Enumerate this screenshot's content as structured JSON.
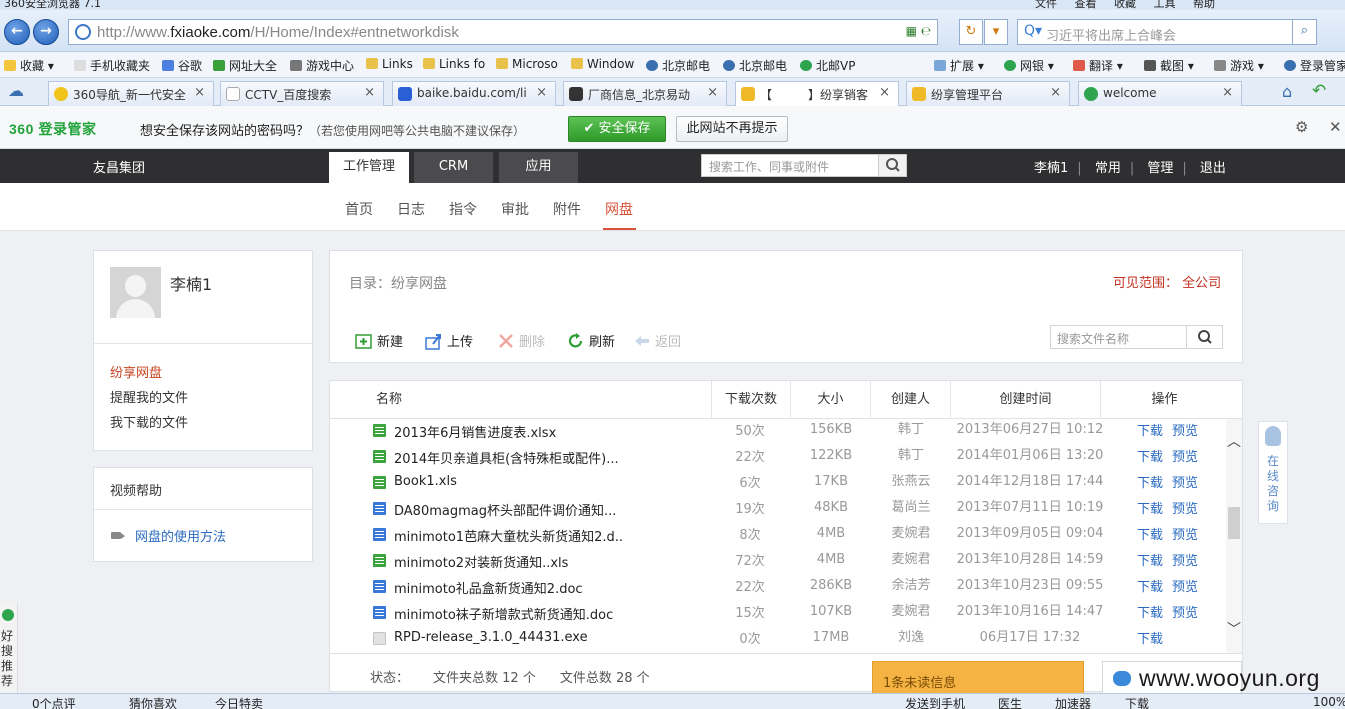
{
  "browser": {
    "title": "360安全浏览器 7.1",
    "menu": [
      "文件",
      "查看",
      "收藏",
      "工具",
      "帮助"
    ],
    "url_prefix": "http://www.",
    "url_domain": "fxiaoke.com",
    "url_path": "/H/Home/Index#entnetworkdisk",
    "search_placeholder": "习近平将出席上合峰会",
    "favorites": [
      "收藏",
      "手机收藏夹",
      "谷歌",
      "网址大全",
      "游戏中心",
      "Links",
      "Links fo",
      "Microso",
      "Window",
      "北京邮电",
      "北京邮电",
      "北邮VP",
      "扩展",
      "网银",
      "翻译",
      "截图",
      "游戏",
      "登录管家"
    ],
    "tabs": [
      "360导航_新一代安全",
      "CCTV_百度搜索",
      "baike.baidu.com/li",
      "厂商信息_北京易动",
      "【　　　】纷享销客",
      "纷享管理平台",
      "welcome"
    ]
  },
  "password_bar": {
    "brand": "360",
    "brand_suffix": "登录管家",
    "message": "想安全保存该网站的密码吗？",
    "note": "（若您使用网吧等公共电脑不建议保存）",
    "save_label": "安全保存",
    "no_prompt_label": "此网站不再提示"
  },
  "header": {
    "company": "友昌集团",
    "main_tabs": [
      "工作管理",
      "CRM",
      "应用"
    ],
    "search_placeholder": "搜索工作、同事或附件",
    "user": "李楠1",
    "links": [
      "常用",
      "管理",
      "退出"
    ]
  },
  "subnav": [
    "首页",
    "日志",
    "指令",
    "审批",
    "附件",
    "网盘"
  ],
  "profile": {
    "name": "李楠1",
    "menu": [
      "纷享网盘",
      "提醒我的文件",
      "我下载的文件"
    ]
  },
  "help": {
    "title": "视频帮助",
    "link": "网盘的使用方法"
  },
  "disk": {
    "dir_label": "目录：纷享网盘",
    "scope_label": "可见范围：",
    "scope_value": "全公司",
    "toolbar": [
      "新建",
      "上传",
      "删除",
      "刷新",
      "返回"
    ],
    "search_placeholder": "搜索文件名称",
    "columns": [
      "名称",
      "下载次数",
      "大小",
      "创建人",
      "创建时间",
      "操作"
    ],
    "files": [
      {
        "type": "xls",
        "name": "2013年6月销售进度表.xlsx",
        "downloads": "50次",
        "size": "156KB",
        "creator": "韩丁",
        "time": "2013年06月27日 10:12",
        "dl": "下载",
        "pv": "预览"
      },
      {
        "type": "xls",
        "name": "2014年贝亲道具柜(含特殊柜或配件)...",
        "downloads": "22次",
        "size": "122KB",
        "creator": "韩丁",
        "time": "2014年01月06日 13:20",
        "dl": "下载",
        "pv": "预览"
      },
      {
        "type": "xls",
        "name": "Book1.xls",
        "downloads": "6次",
        "size": "17KB",
        "creator": "张燕云",
        "time": "2014年12月18日 17:44",
        "dl": "下载",
        "pv": "预览"
      },
      {
        "type": "doc",
        "name": "DA80magmag杯头部配件调价通知...",
        "downloads": "19次",
        "size": "48KB",
        "creator": "葛尚兰",
        "time": "2013年07月11日 10:19",
        "dl": "下载",
        "pv": "预览"
      },
      {
        "type": "doc",
        "name": "minimoto1芭麻大童枕头新货通知2.d...",
        "downloads": "8次",
        "size": "4MB",
        "creator": "麦婉君",
        "time": "2013年09月05日 09:04",
        "dl": "下载",
        "pv": "预览"
      },
      {
        "type": "xls",
        "name": "minimoto2对装新货通知..xls",
        "downloads": "72次",
        "size": "4MB",
        "creator": "麦婉君",
        "time": "2013年10月28日 14:59",
        "dl": "下载",
        "pv": "预览"
      },
      {
        "type": "doc",
        "name": "minimoto礼品盒新货通知2.doc",
        "downloads": "22次",
        "size": "286KB",
        "creator": "余洁芳",
        "time": "2013年10月23日 09:55",
        "dl": "下载",
        "pv": "预览"
      },
      {
        "type": "doc",
        "name": "minimoto袜子新增款式新货通知.doc",
        "downloads": "15次",
        "size": "107KB",
        "creator": "麦婉君",
        "time": "2013年10月16日 14:47",
        "dl": "下载",
        "pv": "预览"
      },
      {
        "type": "exe",
        "name": "RPD-release_3.1.0_44431.exe",
        "downloads": "0次",
        "size": "17MB",
        "creator": "刘逸",
        "time": "06月17日 17:32",
        "dl": "下载",
        "pv": ""
      }
    ],
    "status_label": "状态：",
    "folder_total": "文件夹总数 12 个",
    "file_total": "文件总数 28 个"
  },
  "floaters": {
    "consult": "在线咨询",
    "unread": "1条未读信息",
    "watermark": "www.wooyun.org",
    "left_rail": "好搜推荐"
  },
  "statusbar": [
    "0个点评",
    "猜你喜欢",
    "今日特卖",
    "发送到手机",
    "医生",
    "加速器",
    "下载",
    "100%"
  ],
  "colors": {
    "accent": "#d9533b",
    "link": "#2a6bc1",
    "green": "#2f9a2b",
    "header": "#2f2f31"
  }
}
